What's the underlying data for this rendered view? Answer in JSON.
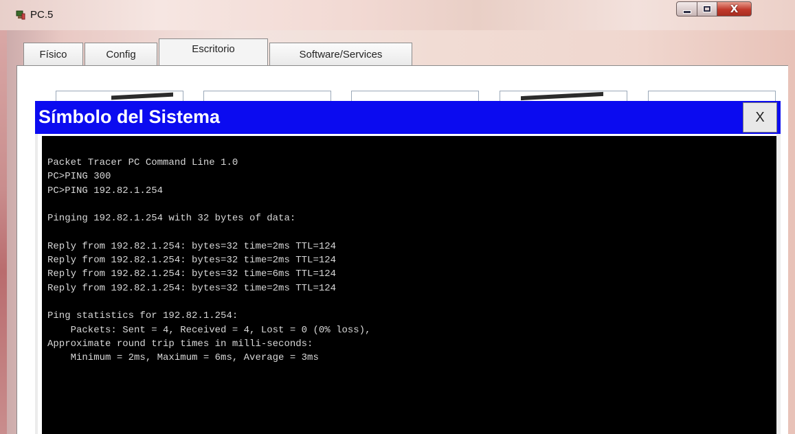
{
  "window": {
    "title": "PC.5",
    "controls": {
      "minimize_icon": "minimize-icon",
      "maximize_icon": "maximize-icon",
      "close_label": "X"
    }
  },
  "tabs": [
    {
      "label": "Físico",
      "active": false
    },
    {
      "label": "Config",
      "active": false
    },
    {
      "label": "Escritorio",
      "active": true
    },
    {
      "label": "Software/Services",
      "active": false
    }
  ],
  "command_prompt": {
    "title": "Símbolo del Sistema",
    "close_label": "X",
    "header_color": "#0b0bf0",
    "lines": [
      "Packet Tracer PC Command Line 1.0",
      "PC>PING 300",
      "PC>PING 192.82.1.254",
      "",
      "Pinging 192.82.1.254 with 32 bytes of data:",
      "",
      "Reply from 192.82.1.254: bytes=32 time=2ms TTL=124",
      "Reply from 192.82.1.254: bytes=32 time=2ms TTL=124",
      "Reply from 192.82.1.254: bytes=32 time=6ms TTL=124",
      "Reply from 192.82.1.254: bytes=32 time=2ms TTL=124",
      "",
      "Ping statistics for 192.82.1.254:",
      "    Packets: Sent = 4, Received = 4, Lost = 0 (0% loss),",
      "Approximate round trip times in milli-seconds:",
      "    Minimum = 2ms, Maximum = 6ms, Average = 3ms"
    ]
  }
}
